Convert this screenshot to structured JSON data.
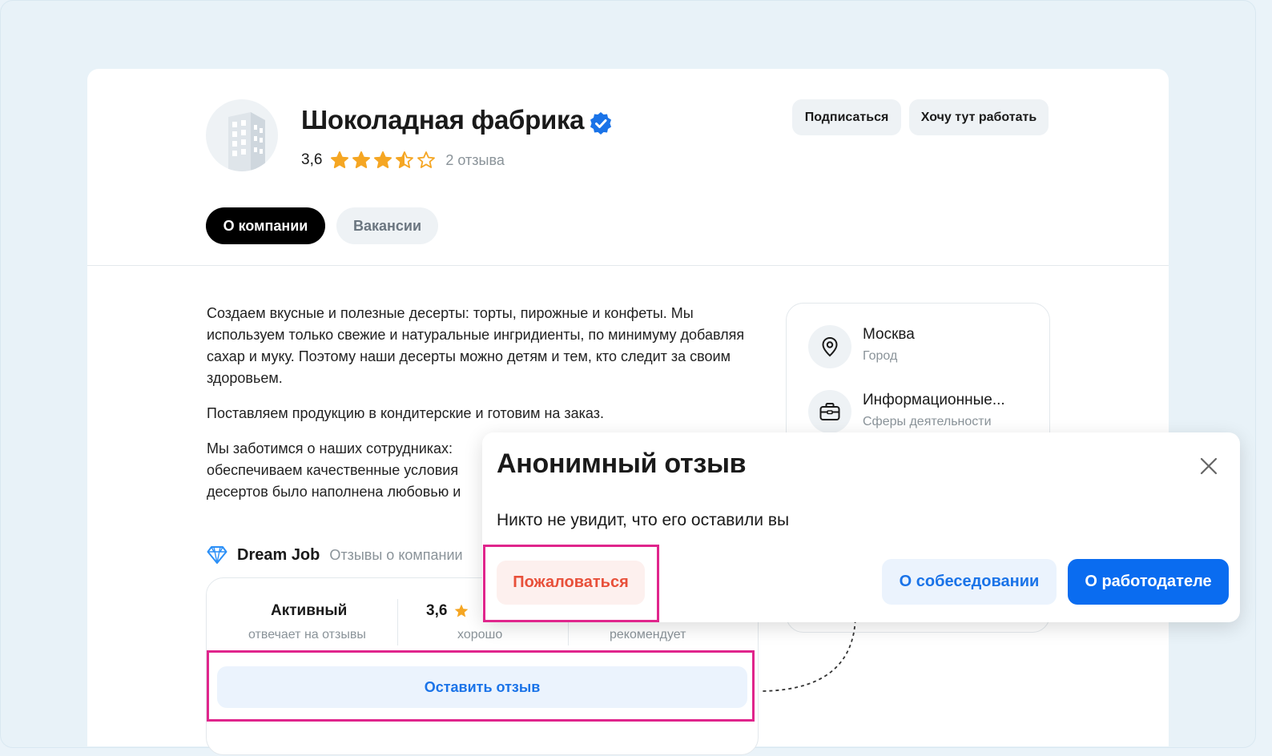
{
  "company": {
    "name": "Шоколадная фабрика",
    "verified_icon": "verified-badge-icon",
    "rating": "3,6",
    "stars": 3.5,
    "reviews_count": "2 отзыва",
    "logo_icon": "building-icon"
  },
  "header_buttons": {
    "subscribe": "Подписаться",
    "want_work": "Хочу тут работать"
  },
  "tabs": [
    {
      "label": "О компании",
      "active": true
    },
    {
      "label": "Вакансии",
      "active": false
    }
  ],
  "description": [
    "Создаем вкусные и полезные десерты: торты, пирожные и конфеты. Мы используем только свежие и натуральные ингридиенты, по минимуму добавляя сахар и муку. Поэтому наши десерты можно детям и тем, кто следит за своим здоровьем.",
    "Поставляем продукцию в кондитерские и готовим на заказ.",
    "Мы заботимся о наших сотрудниках: обеспечиваем качественные условия десертов было наполнена любовью и"
  ],
  "info": [
    {
      "title": "Москва",
      "subtitle": "Город",
      "icon": "location-pin-icon"
    },
    {
      "title": "Информационные...",
      "subtitle": "Сферы деятельности",
      "icon": "briefcase-icon"
    }
  ],
  "dream_job": {
    "name": "Dream Job",
    "subtitle": "Отзывы о компании",
    "icon": "diamond-icon"
  },
  "stats": [
    {
      "main": "Активный",
      "sub": "отвечает на отзывы"
    },
    {
      "main": "3,6",
      "sub": "хорошо"
    },
    {
      "main": "",
      "sub": "рекомендует"
    }
  ],
  "leave_review": "Оставить отзыв",
  "modal": {
    "title": "Анонимный отзыв",
    "text": "Никто не увидит, что его оставили вы",
    "complain": "Пожаловаться",
    "interview": "О собеседовании",
    "employer": "О работодателе",
    "close_icon": "close-icon"
  },
  "colors": {
    "accent_blue": "#0a6cf0",
    "star": "#f5a623",
    "highlight": "#e0258c",
    "complain": "#e8503a"
  }
}
